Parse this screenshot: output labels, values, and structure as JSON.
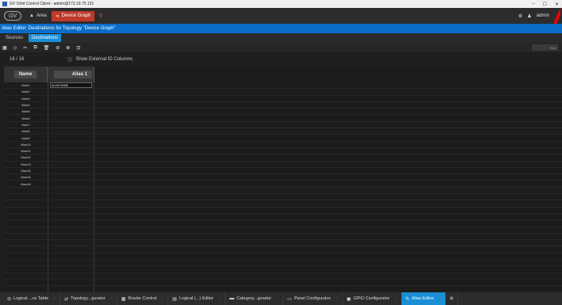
{
  "window": {
    "title": "GV Orbit Control Client - admin@172.19.75.131",
    "controls": [
      "–",
      "☐",
      "✕"
    ]
  },
  "topbar": {
    "logo": "GV",
    "area_label": "Area",
    "graph_label": "Device Graph",
    "user": "admin"
  },
  "panel_title": "Alias Editor: Destinations for Topology \"Device Graph\"",
  "subtabs": [
    {
      "label": "Sources"
    },
    {
      "label": "Destinations"
    }
  ],
  "toolbar": {
    "icons": [
      "▦",
      "◇",
      "✂",
      "⧉",
      "🗑",
      "⊘",
      "⊕",
      "⊡"
    ],
    "filter_placeholder": "filter"
  },
  "count": "16 / 16",
  "show_external": "Show External ID Columns",
  "columns": {
    "name": "Name",
    "alias": "Alias 1"
  },
  "rows": [
    {
      "name": "Mon1",
      "alias": "ALIAS NAME"
    },
    {
      "name": "Mon2",
      "alias": ""
    },
    {
      "name": "Mon3",
      "alias": ""
    },
    {
      "name": "Mon4",
      "alias": ""
    },
    {
      "name": "Mon5",
      "alias": ""
    },
    {
      "name": "Mon6",
      "alias": ""
    },
    {
      "name": "Mon7",
      "alias": ""
    },
    {
      "name": "Mon8",
      "alias": ""
    },
    {
      "name": "Mon9",
      "alias": ""
    },
    {
      "name": "Mon10",
      "alias": ""
    },
    {
      "name": "Mon11",
      "alias": ""
    },
    {
      "name": "Mon12",
      "alias": ""
    },
    {
      "name": "Mon13",
      "alias": ""
    },
    {
      "name": "Mon14",
      "alias": ""
    },
    {
      "name": "Mon15",
      "alias": ""
    },
    {
      "name": "Mon16",
      "alias": ""
    }
  ],
  "bottom_tabs": [
    {
      "label": "Logical ...ce Table",
      "icon": "⊖"
    },
    {
      "label": "Topology...gurator",
      "icon": "⇄"
    },
    {
      "label": "Router Control",
      "icon": "▦"
    },
    {
      "label": "Logical (...) Editor",
      "icon": "▤"
    },
    {
      "label": "Category...gurator",
      "icon": "▬"
    },
    {
      "label": "Panel Configurator",
      "icon": "▭"
    },
    {
      "label": "GPIO Configurator",
      "icon": "▣"
    },
    {
      "label": "Alias Editor",
      "icon": "✎"
    }
  ]
}
